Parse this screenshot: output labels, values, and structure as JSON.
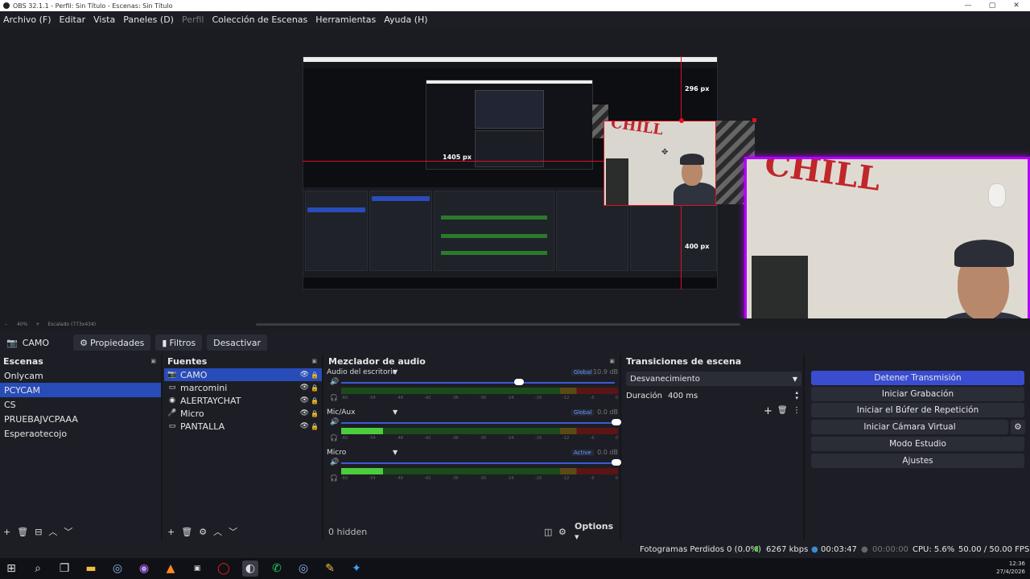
{
  "window": {
    "title": "OBS 32.1.1 - Perfil: Sin Título - Escenas: Sin Título"
  },
  "menu": [
    "Archivo (F)",
    "Editar",
    "Vista",
    "Paneles (D)",
    "Perfil",
    "Colección de Escenas",
    "Herramientas",
    "Ayuda (H)"
  ],
  "preview": {
    "zoom": "40%",
    "scale_label": "Escalado (773x434)",
    "dim_top": "296 px",
    "dim_left": "1405 px",
    "dim_bottom": "400 px",
    "wall_text": "CHILL"
  },
  "source_toolbar": {
    "selected_source": "CAMO",
    "properties": "Propiedades",
    "filters": "Filtros",
    "deactivate": "Desactivar"
  },
  "scenes": {
    "title": "Escenas",
    "items": [
      "Onlycam",
      "PCYCAM",
      "CS",
      "PRUEBAJVCPAAA",
      "Esperaotecojo"
    ],
    "selected_index": 1
  },
  "sources": {
    "title": "Fuentes",
    "items": [
      {
        "name": "CAMO",
        "icon": "camera-icon"
      },
      {
        "name": "marcomini",
        "icon": "window-icon"
      },
      {
        "name": "ALERTAYCHAT",
        "icon": "globe-icon"
      },
      {
        "name": "Micro",
        "icon": "microphone-icon"
      },
      {
        "name": "PANTALLA",
        "icon": "monitor-icon"
      }
    ],
    "selected_index": 0
  },
  "mixer": {
    "title": "Mezclador de audio",
    "channels": [
      {
        "name": "Audio del escritorio",
        "tag": "Global",
        "db": "10.9 dB",
        "volume": 0.64,
        "level": 0.0
      },
      {
        "name": "Mic/Aux",
        "tag": "Global",
        "db": "0.0 dB",
        "volume": 1.0,
        "level": 0.15
      },
      {
        "name": "Micro",
        "tag": "Active",
        "db": "0.0 dB",
        "volume": 1.0,
        "level": 0.15
      }
    ],
    "ticks": [
      "-60",
      "-54",
      "-48",
      "-42",
      "-36",
      "-30",
      "-24",
      "-18",
      "-12",
      "-6",
      "0"
    ],
    "hidden_label": "0 hidden",
    "options_label": "Options"
  },
  "transitions": {
    "title": "Transiciones de escena",
    "selected": "Desvanecimiento",
    "duration_label": "Duración",
    "duration_value": "400 ms"
  },
  "controls": {
    "stream": "Detener Transmisión",
    "record": "Iniciar Grabación",
    "replay": "Iniciar el Búfer de Repetición",
    "virtualcam": "Iniciar Cámara Virtual",
    "studio": "Modo Estudio",
    "settings": "Ajustes"
  },
  "status": {
    "dropped": "Fotogramas Perdidos 0 (0.0%)",
    "bitrate": "6267 kbps",
    "stream_time": "00:03:47",
    "rec_time": "00:00:00",
    "cpu": "CPU: 5.6%",
    "fps": "50.00 / 50.00 FPS"
  },
  "clock": {
    "time": "12:36",
    "date": "27/4/2026"
  }
}
